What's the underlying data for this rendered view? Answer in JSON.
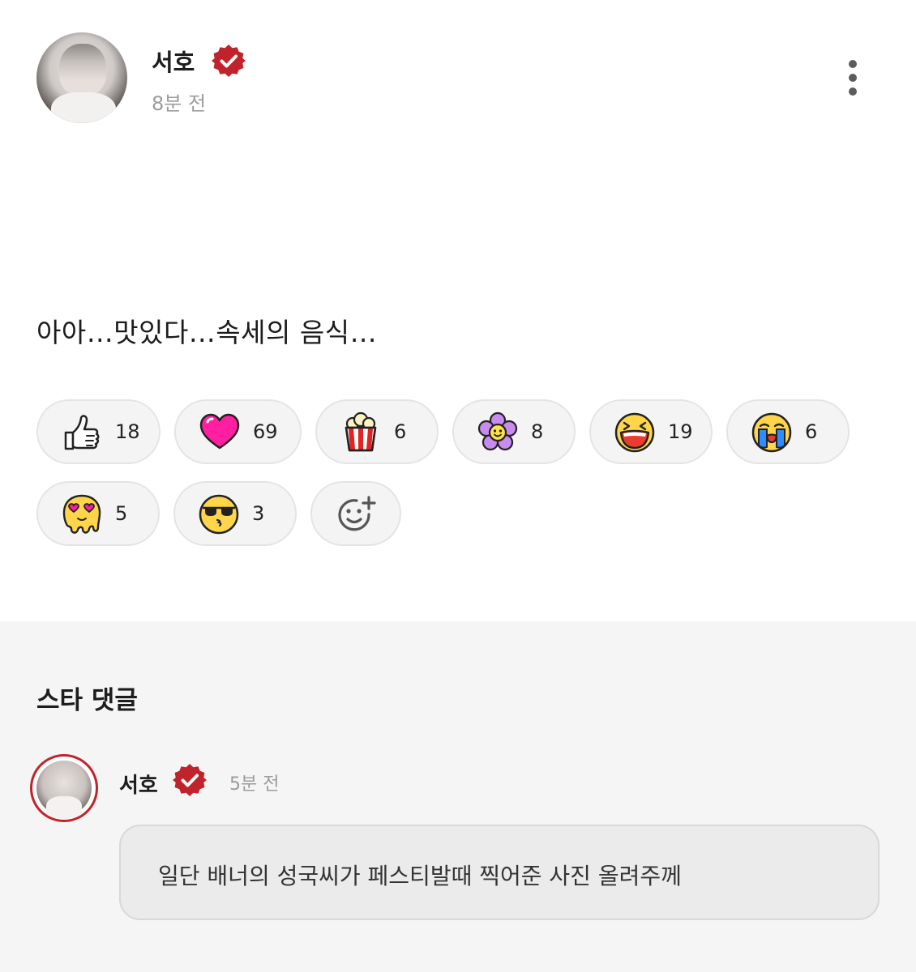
{
  "post": {
    "author": {
      "name": "서호",
      "verified": true,
      "time": "8분 전"
    },
    "text": "아아…맛있다…속세의 음식…",
    "reactions": [
      {
        "icon": "thumbs-up-icon",
        "count": "18"
      },
      {
        "icon": "heart-icon",
        "count": "69"
      },
      {
        "icon": "popcorn-icon",
        "count": "6"
      },
      {
        "icon": "flower-icon",
        "count": "8"
      },
      {
        "icon": "laughing-face-icon",
        "count": "19"
      },
      {
        "icon": "crying-face-icon",
        "count": "6"
      },
      {
        "icon": "melting-heart-eyes-icon",
        "count": "5"
      },
      {
        "icon": "sunglasses-kiss-icon",
        "count": "3"
      }
    ],
    "add_reaction_icon": "add-emoji-icon"
  },
  "comments": {
    "section_title": "스타 댓글",
    "items": [
      {
        "author": "서호",
        "verified": true,
        "time": "5분 전",
        "text": "일단 배너의 성국씨가 페스티발때 찍어준 사진 올려주께"
      }
    ]
  },
  "colors": {
    "accent": "#c0232c",
    "background": "#ffffff",
    "comment_section": "#f5f5f5"
  }
}
